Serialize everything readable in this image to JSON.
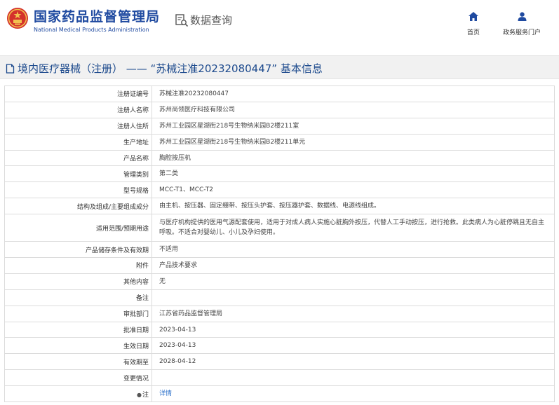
{
  "header": {
    "logo_cn": "国家药品监督管理局",
    "logo_en": "National Medical Products Administration",
    "query_title": "数据查询",
    "nav": [
      {
        "label": "首页",
        "icon": "home-icon"
      },
      {
        "label": "政务服务门户",
        "icon": "user-icon"
      }
    ]
  },
  "title": "境内医疗器械（注册） —— “苏械注准20232080447” 基本信息",
  "colors": {
    "brand": "#1f4aa0",
    "title": "#1d4a8d",
    "link": "#2a6fc9",
    "band": "#f1f1f1"
  },
  "rows": [
    {
      "label": "注册证编号",
      "value": "苏械注准20232080447"
    },
    {
      "label": "注册人名称",
      "value": "苏州尚领医疗科技有限公司"
    },
    {
      "label": "注册人住所",
      "value": "苏州工业园区星湖街218号生物纳米园B2楼211室"
    },
    {
      "label": "生产地址",
      "value": "苏州工业园区星湖街218号生物纳米园B2楼211单元"
    },
    {
      "label": "产品名称",
      "value": "胸腔按压机"
    },
    {
      "label": "管理类别",
      "value": "第二类"
    },
    {
      "label": "型号规格",
      "value": "MCC-T1、MCC-T2"
    },
    {
      "label": "结构及组成/主要组成成分",
      "value": "由主机、按压器、固定绷带、按压头护套、按压器护套、数据线、电源线组成。"
    },
    {
      "label": "适用范围/预期用途",
      "value": "与医疗机构提供的医用气源配套使用，适用于对成人病人实施心脏胸外按压，代替人工手动按压，进行抢救。此类病人为心脏停跳且无自主呼吸。不适合对婴幼儿、小儿及孕妇使用。"
    },
    {
      "label": "产品储存条件及有效期",
      "value": "不适用"
    },
    {
      "label": "附件",
      "value": "产品技术要求"
    },
    {
      "label": "其他内容",
      "value": "无"
    },
    {
      "label": "备注",
      "value": ""
    },
    {
      "label": "审批部门",
      "value": "江苏省药品监督管理局"
    },
    {
      "label": "批准日期",
      "value": "2023-04-13"
    },
    {
      "label": "生效日期",
      "value": "2023-04-13"
    },
    {
      "label": "有效期至",
      "value": "2028-04-12"
    },
    {
      "label": "变更情况",
      "value": ""
    },
    {
      "label": "注",
      "value": "详情"
    }
  ]
}
